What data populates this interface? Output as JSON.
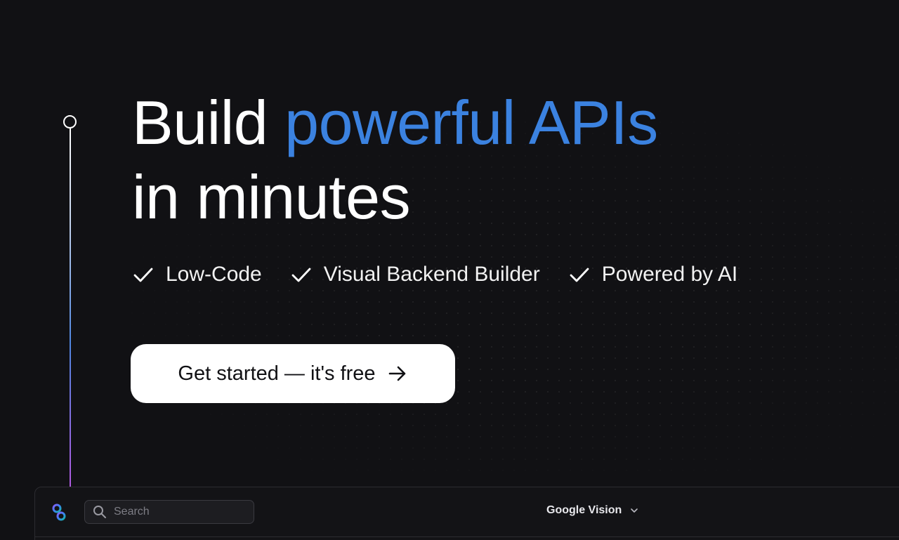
{
  "hero": {
    "headline_part1": "Build ",
    "headline_accent": "powerful APIs",
    "headline_line2": "in minutes",
    "accent_color": "#3b82e0"
  },
  "features": [
    {
      "icon": "check-icon",
      "label": "Low-Code"
    },
    {
      "icon": "check-icon",
      "label": "Visual Backend Builder"
    },
    {
      "icon": "check-icon",
      "label": "Powered by AI"
    }
  ],
  "cta": {
    "label": "Get started — it's free",
    "icon": "arrow-right-icon"
  },
  "app_bar": {
    "logo": "app-logo-icon",
    "search_placeholder": "Search",
    "search_value": "",
    "project_name": "Google Vision",
    "project_icon": "chevron-down-icon"
  },
  "colors": {
    "background": "#111114",
    "timeline_gradient": [
      "#ffffff",
      "#4f86e0",
      "#b05ae0"
    ],
    "cta_background": "#ffffff"
  }
}
